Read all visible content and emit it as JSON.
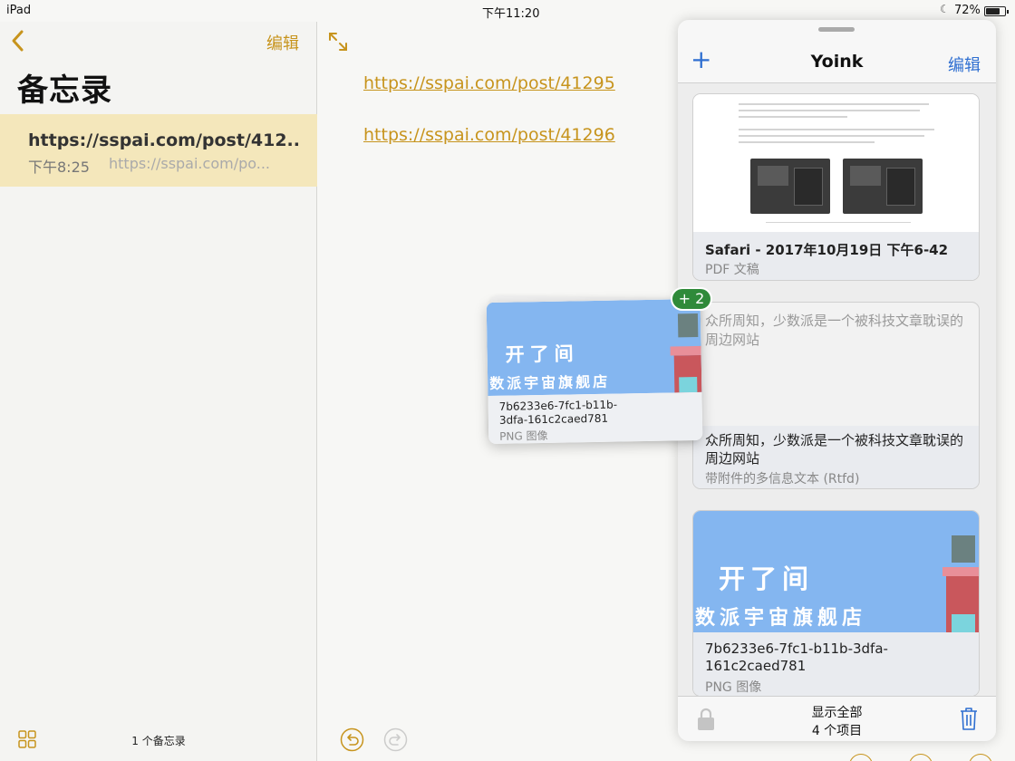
{
  "status_bar": {
    "device": "iPad",
    "time": "下午11:20",
    "battery": "72%"
  },
  "notes_list": {
    "edit_label": "编辑",
    "title": "备忘录",
    "note": {
      "title": "https://sspai.com/post/412...",
      "time": "下午8:25",
      "preview": "https://sspai.com/po..."
    },
    "count": "1 个备忘录"
  },
  "note_detail": {
    "links": [
      "https://sspai.com/post/41295",
      "https://sspai.com/post/41296"
    ]
  },
  "yoink": {
    "add_label": "+",
    "title": "Yoink",
    "edit_label": "编辑",
    "items": [
      {
        "name": "Safari - 2017年10月19日 下午6-42",
        "type": "PDF 文稿"
      },
      {
        "content": "众所周知，少数派是一个被科技文章耽误的周边网站",
        "name": "众所周知，少数派是一个被科技文章耽误的周边网站",
        "type": "带附件的多信息文本 (Rtfd)"
      },
      {
        "banner_line1": "开了间",
        "banner_line2": "数派宇宙旗舰店",
        "name": "7b6233e6-7fc1-b11b-3dfa-161c2caed781",
        "type": "PNG 图像"
      }
    ],
    "footer": {
      "show_all": "显示全部",
      "item_count": "4 个项目"
    }
  },
  "drag_preview": {
    "banner_line1": "开了间",
    "banner_line2": "数派宇宙旗舰店",
    "name": "7b6233e6-7fc1-b11b-3dfa-161c2caed781",
    "type": "PNG 图像",
    "badge": "+ 2"
  },
  "colors": {
    "notes_accent": "#c7941d",
    "yoink_accent": "#2f6fd1",
    "selected_note": "#f4e7bb",
    "badge": "#2f8a3a",
    "banner": "#84b6f0"
  }
}
